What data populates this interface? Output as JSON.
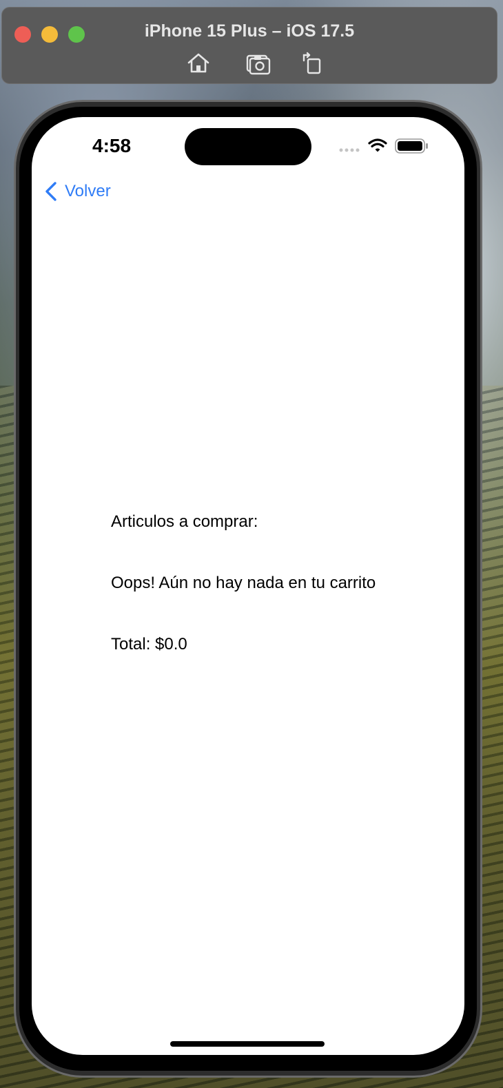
{
  "window": {
    "title": "iPhone 15 Plus – iOS 17.5",
    "toolbar_icons": [
      "home-icon",
      "screenshot-icon",
      "rotate-icon"
    ]
  },
  "status_bar": {
    "time": "4:58",
    "icons": [
      "cellular-signal-icon",
      "wifi-icon",
      "battery-icon"
    ]
  },
  "nav": {
    "back_label": "Volver",
    "accent_color": "#2f7cf6"
  },
  "cart": {
    "heading": "Articulos a comprar:",
    "empty_message": "Oops! Aún no hay nada en tu carrito",
    "total": "Total: $0.0"
  }
}
